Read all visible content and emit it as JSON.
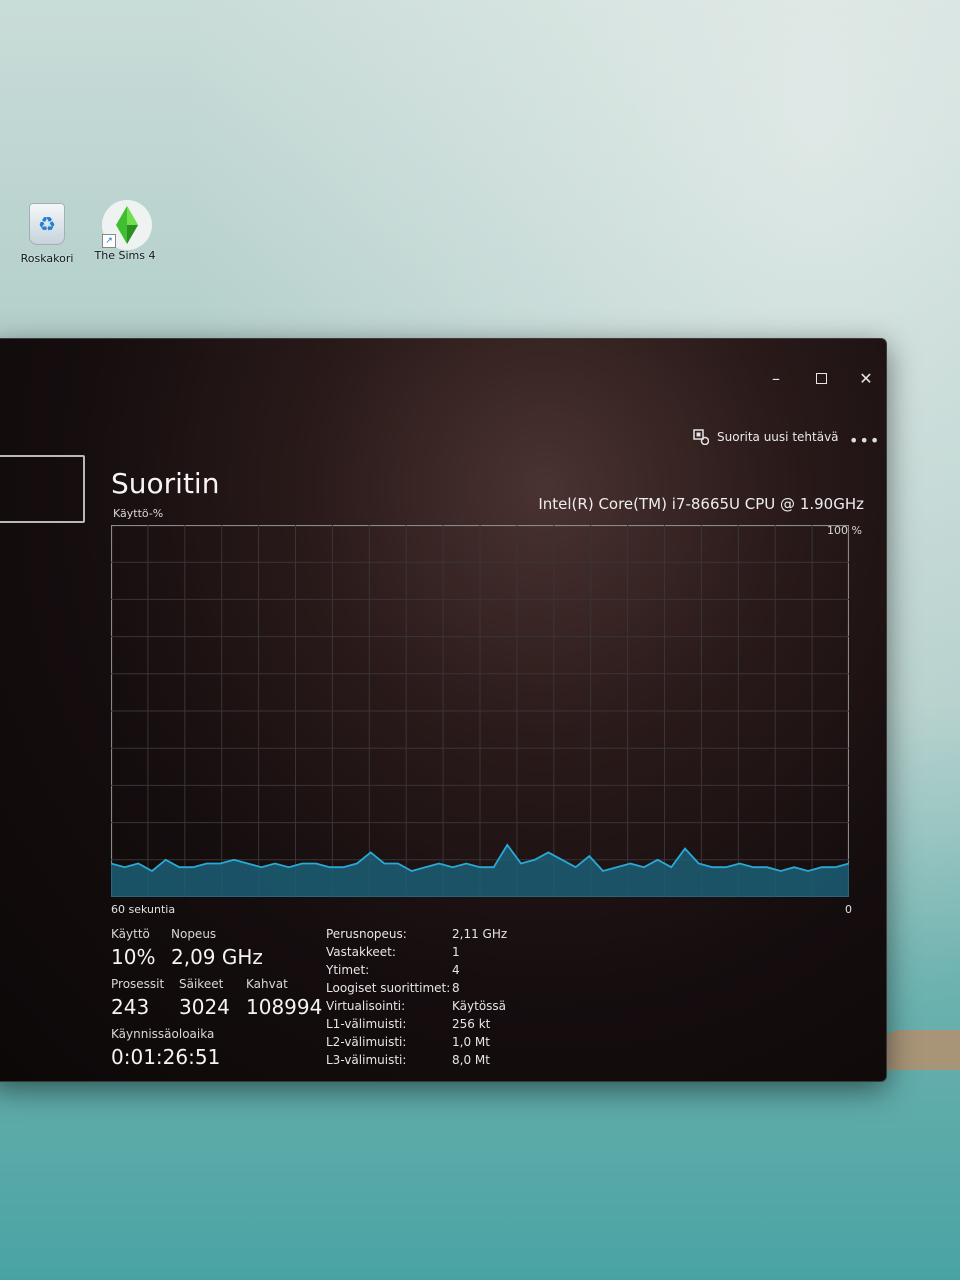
{
  "desktop": {
    "icons": [
      {
        "label": "Roskakori",
        "icon": "recycle-bin-icon"
      },
      {
        "label": "The Sims 4",
        "icon": "sims-plumbob-icon"
      }
    ]
  },
  "window": {
    "run_task_label": "Suorita uusi tehtävä",
    "title": "Suoritin",
    "cpu_name": "Intel(R) Core(TM) i7-8665U CPU @ 1.90GHz",
    "graph": {
      "utilization_label": "Käyttö-%",
      "max_label": "100 %",
      "time_left_label": "60 sekuntia",
      "time_right_label": "0",
      "line_color": "#2aa9d6",
      "fill_color": "#1b5e76",
      "values": [
        9,
        8,
        9,
        7,
        10,
        8,
        8,
        9,
        9,
        10,
        9,
        8,
        9,
        8,
        9,
        9,
        8,
        8,
        9,
        12,
        9,
        9,
        7,
        8,
        9,
        8,
        9,
        8,
        8,
        14,
        9,
        10,
        12,
        10,
        8,
        11,
        7,
        8,
        9,
        8,
        10,
        8,
        13,
        9,
        8,
        8,
        9,
        8,
        8,
        7,
        8,
        7,
        8,
        8,
        9
      ]
    },
    "stats": {
      "usage": {
        "label": "Käyttö",
        "value": "10%"
      },
      "speed": {
        "label": "Nopeus",
        "value": "2,09 GHz"
      },
      "processes": {
        "label": "Prosessit",
        "value": "243"
      },
      "threads": {
        "label": "Säikeet",
        "value": "3024"
      },
      "handles": {
        "label": "Kahvat",
        "value": "108994"
      },
      "uptime": {
        "label": "Käynnissäoloaika",
        "value": "0:01:26:51"
      }
    },
    "specs": [
      {
        "label": "Perusnopeus:",
        "value": "2,11 GHz"
      },
      {
        "label": "Vastakkeet:",
        "value": "1"
      },
      {
        "label": "Ytimet:",
        "value": "4"
      },
      {
        "label": "Loogiset suorittimet:",
        "value": "8"
      },
      {
        "label": "Virtualisointi:",
        "value": "Käytössä"
      },
      {
        "label": "L1-välimuisti:",
        "value": "256 kt"
      },
      {
        "label": "L2-välimuisti:",
        "value": "1,0 Mt"
      },
      {
        "label": "L3-välimuisti:",
        "value": "8,0 Mt"
      }
    ]
  }
}
